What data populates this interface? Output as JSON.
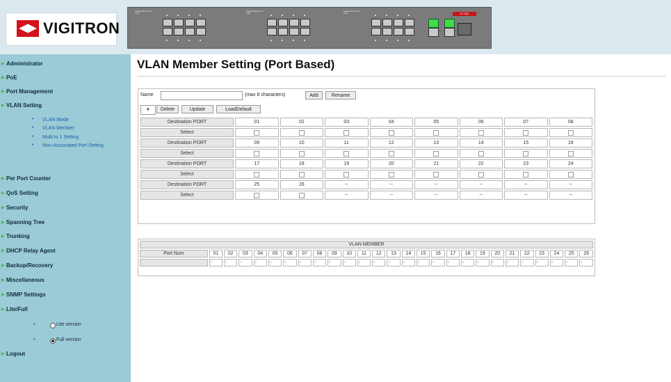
{
  "brand": {
    "logo_text": "VIGITRON",
    "logo_mark": "◀▶"
  },
  "panel": {
    "group_labels": [
      "Gigabit Ethernet & PoE",
      "Gigabit Ethernet & PoE",
      "Gigabit Ethernet & PoE"
    ],
    "tag": "VI-TAG"
  },
  "sidebar": {
    "items": [
      {
        "label": "Administrator"
      },
      {
        "label": "PoE"
      },
      {
        "label": "Port Management"
      },
      {
        "label": "VLAN Setting"
      },
      {
        "label": "Per Port Counter"
      },
      {
        "label": "QoS Setting"
      },
      {
        "label": "Security"
      },
      {
        "label": "Spanning Tree"
      },
      {
        "label": "Trunking"
      },
      {
        "label": "DHCP Relay Agent"
      },
      {
        "label": "Backup/Recovery"
      },
      {
        "label": "Miscellaneous"
      },
      {
        "label": "SNMP Settings"
      },
      {
        "label": "Lite/Full"
      },
      {
        "label": "Logout"
      }
    ],
    "vlan_sub": [
      "VLAN Mode",
      "VLAN Member",
      "Multi to 1 Setting",
      "Non-Associated Port Setting"
    ],
    "lite_full": [
      {
        "label": "Lite version",
        "selected": false
      },
      {
        "label": "Full version",
        "selected": true
      }
    ]
  },
  "main": {
    "title": "VLAN Member Setting (Port Based)",
    "name_label": "Name",
    "name_value": "",
    "name_hint": "(max 8 characters)",
    "add_label": "Add",
    "rename_label": "Rename",
    "select_value": "▼",
    "delete_label": "Delete",
    "update_label": "Update",
    "load_default_label": "LoadDefault",
    "dest_port_label": "Destination PORT",
    "select_label": "Select",
    "port_rows": [
      [
        "01",
        "02",
        "03",
        "04",
        "05",
        "06",
        "07",
        "08"
      ],
      [
        "09",
        "10",
        "11",
        "12",
        "13",
        "14",
        "15",
        "16"
      ],
      [
        "17",
        "18",
        "19",
        "20",
        "21",
        "22",
        "23",
        "24"
      ],
      [
        "25",
        "26",
        "--",
        "--",
        "--",
        "--",
        "--",
        "--"
      ]
    ],
    "member": {
      "title": "VLAN MEMBER",
      "port_num_label": "Port Num",
      "ports": [
        "01",
        "02",
        "03",
        "04",
        "05",
        "06",
        "07",
        "08",
        "09",
        "10",
        "11",
        "12",
        "13",
        "14",
        "15",
        "16",
        "17",
        "18",
        "19",
        "20",
        "21",
        "22",
        "23",
        "24",
        "25",
        "26"
      ],
      "values": [
        "-",
        "-",
        "-",
        "-",
        "-",
        "-",
        "-",
        "-",
        "-",
        "-",
        "-",
        "-",
        "-",
        "-",
        "-",
        "-",
        "-",
        "-",
        "-",
        "-",
        "-",
        "-",
        "-",
        "-",
        "-",
        "-"
      ]
    }
  }
}
